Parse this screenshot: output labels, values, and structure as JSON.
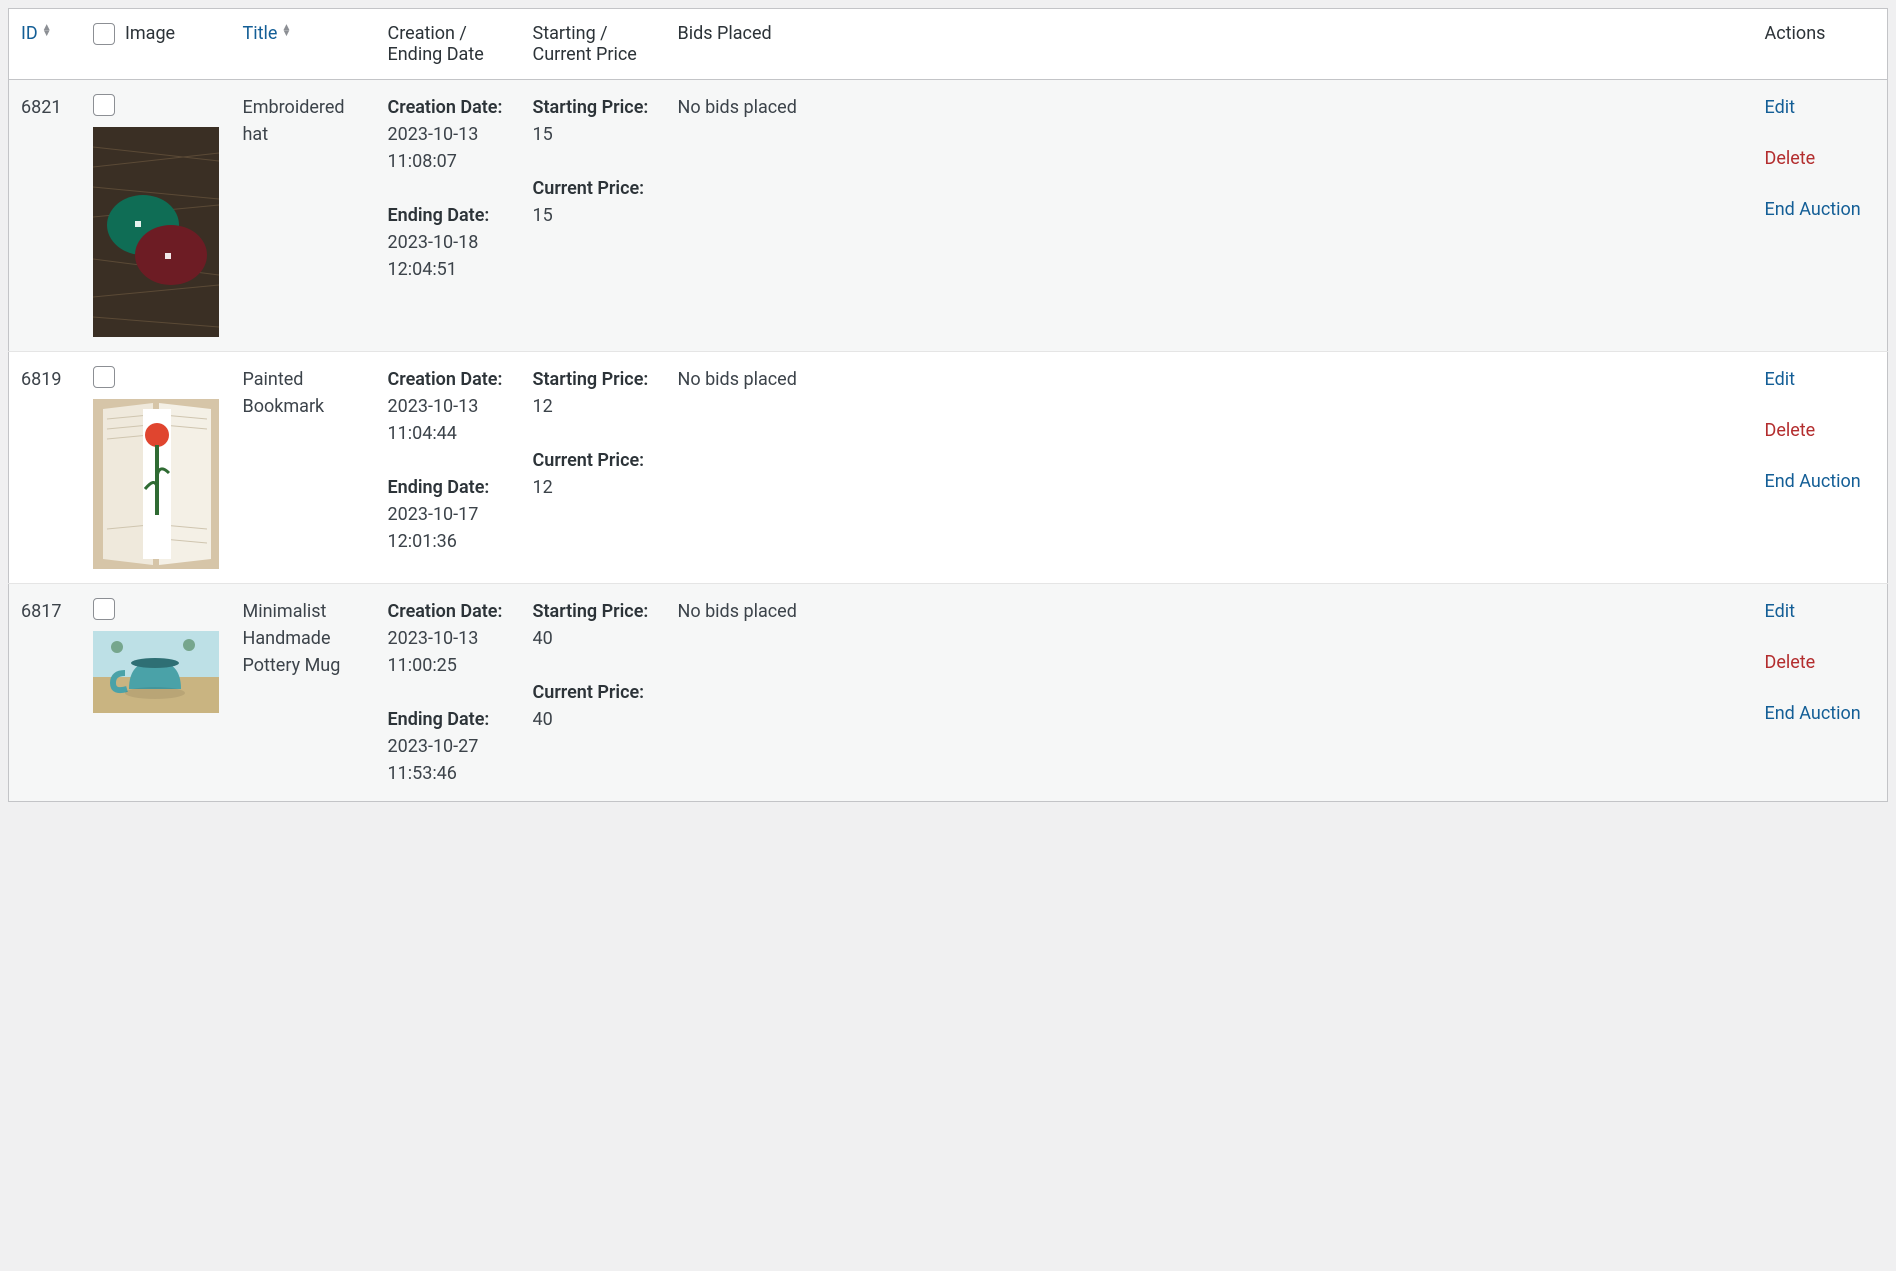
{
  "headers": {
    "id": "ID",
    "image": "Image",
    "title": "Title",
    "dates": "Creation / Ending Date",
    "price": "Starting / Current Price",
    "bids": "Bids Placed",
    "actions": "Actions"
  },
  "labels": {
    "creation_date": "Creation Date:",
    "ending_date": "Ending Date:",
    "starting_price": "Starting Price:",
    "current_price": "Current Price:",
    "edit": "Edit",
    "delete": "Delete",
    "end_auction": "End Auction"
  },
  "rows": [
    {
      "id": "6821",
      "title": "Embroidered hat",
      "creation_date": "2023-10-13 11:08:07",
      "ending_date": "2023-10-18 12:04:51",
      "starting_price": "15",
      "current_price": "15",
      "bids": "No bids placed"
    },
    {
      "id": "6819",
      "title": "Painted Bookmark",
      "creation_date": "2023-10-13 11:04:44",
      "ending_date": "2023-10-17 12:01:36",
      "starting_price": "12",
      "current_price": "12",
      "bids": "No bids placed"
    },
    {
      "id": "6817",
      "title": "Minimalist Handmade Pottery Mug",
      "creation_date": "2023-10-13 11:00:25",
      "ending_date": "2023-10-27 11:53:46",
      "starting_price": "40",
      "current_price": "40",
      "bids": "No bids placed"
    }
  ]
}
